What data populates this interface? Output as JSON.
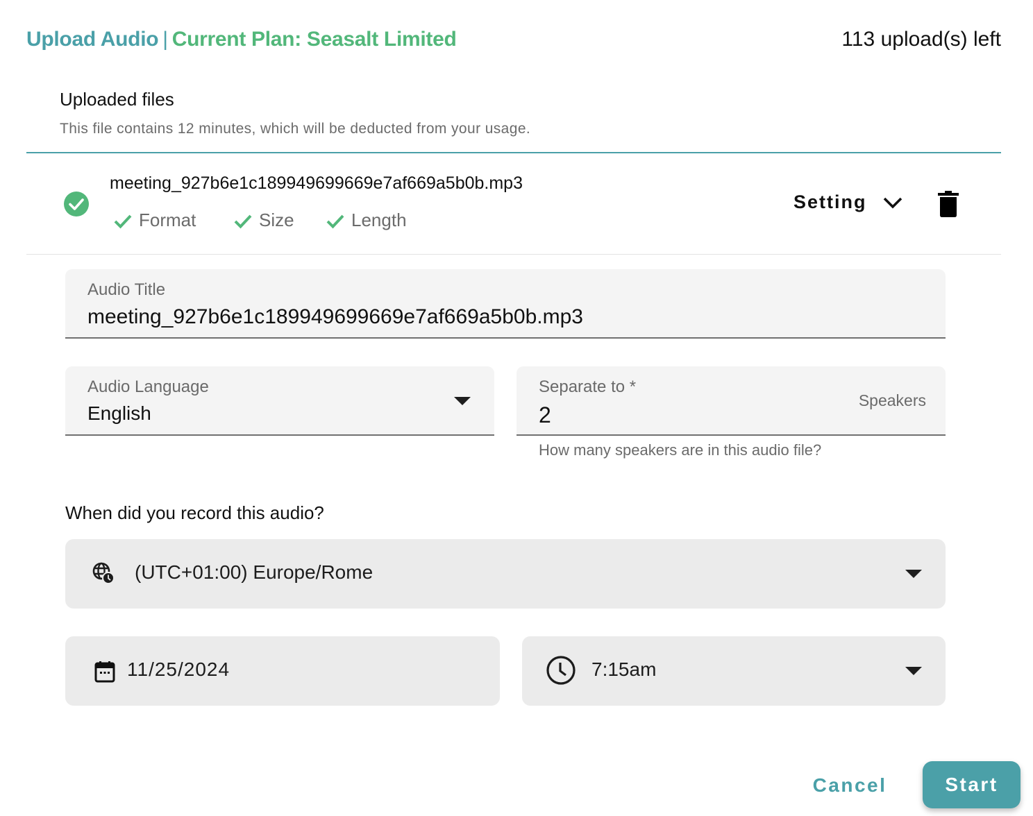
{
  "header": {
    "title": "Upload Audio",
    "separator": "|",
    "plan": "Current Plan: Seasalt Limited",
    "uploads_left": "113 upload(s) left"
  },
  "colors": {
    "teal": "#4aa0a8",
    "green": "#52b77a"
  },
  "uploaded": {
    "label": "Uploaded files",
    "note": "This file contains 12 minutes, which will be deducted from your usage."
  },
  "file": {
    "name": "meeting_927b6e1c189949699669e7af669a5b0b.mp3",
    "status_icon": "check-circle-icon",
    "checks": [
      {
        "label": "Format",
        "icon": "check-icon"
      },
      {
        "label": "Size",
        "icon": "check-icon"
      },
      {
        "label": "Length",
        "icon": "check-icon"
      }
    ],
    "setting_label": "Setting",
    "setting_icon": "chevron-down-icon",
    "delete_icon": "trash-icon"
  },
  "form": {
    "audio_title": {
      "label": "Audio Title",
      "value": "meeting_927b6e1c189949699669e7af669a5b0b.mp3"
    },
    "audio_language": {
      "label": "Audio Language",
      "value": "English"
    },
    "separate_to": {
      "label": "Separate to *",
      "value": "2",
      "suffix": "Speakers",
      "helper": "How many speakers are in this audio file?"
    },
    "when_label": "When did you record this audio?",
    "timezone": {
      "icon": "globe-clock-icon",
      "value": "(UTC+01:00) Europe/Rome"
    },
    "date": {
      "icon": "calendar-icon",
      "value": "11/25/2024"
    },
    "time": {
      "icon": "clock-icon",
      "value": "7:15am"
    }
  },
  "actions": {
    "cancel": "Cancel",
    "start": "Start"
  }
}
